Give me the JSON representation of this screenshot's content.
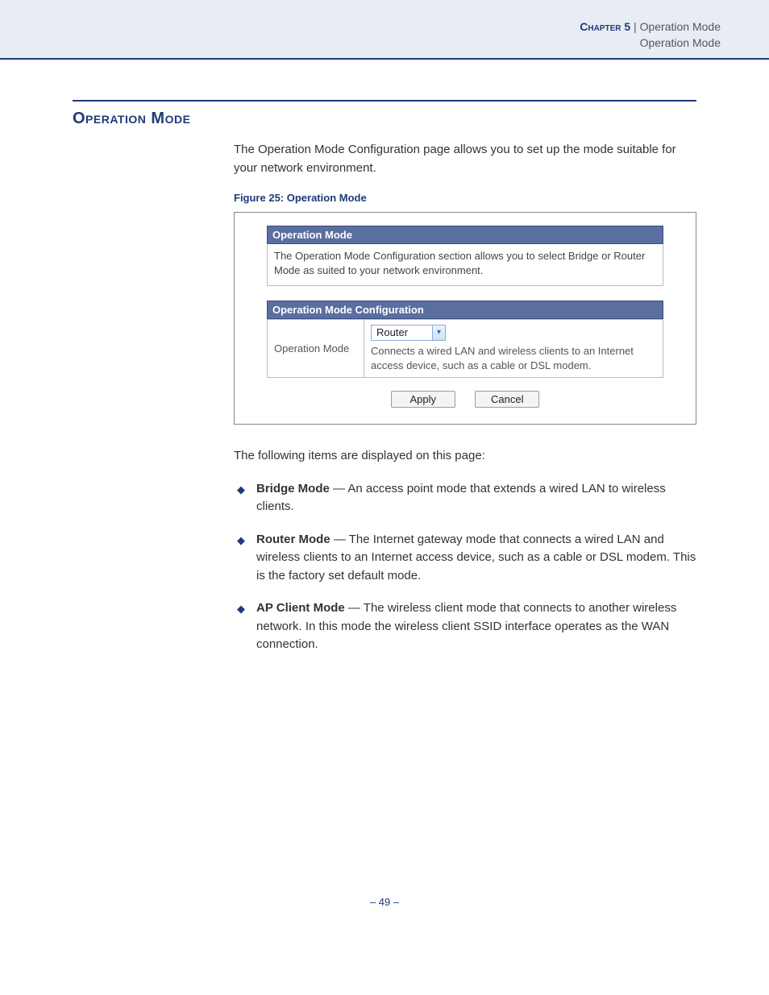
{
  "header": {
    "chapter_label": "Chapter 5",
    "separator": "  |  ",
    "crumb1": "Operation Mode",
    "crumb2": "Operation Mode"
  },
  "section_heading": "Operation Mode",
  "intro_para": "The Operation Mode Configuration page allows you to set up the mode suitable for your network environment.",
  "figure": {
    "caption": "Figure 25:  Operation Mode",
    "panel_title": "Operation Mode",
    "panel_desc": "The Operation Mode Configuration section allows you to select Bridge or Router Mode as suited to your network environment.",
    "cfg_title": "Operation Mode Configuration",
    "row_label": "Operation Mode",
    "select_value": "Router",
    "hint": "Connects a wired LAN and wireless clients to an Internet access device, such as a cable or DSL modem.",
    "apply": "Apply",
    "cancel": "Cancel"
  },
  "followup_para": "The following items are displayed on this page:",
  "items": [
    {
      "name": "Bridge Mode",
      "desc": " — An access point mode that extends a wired LAN to wireless clients."
    },
    {
      "name": "Router Mode",
      "desc": " — The Internet gateway mode that connects a wired LAN and wireless clients to an Internet access device, such as a cable or DSL modem. This is the factory set default mode."
    },
    {
      "name": "AP Client Mode",
      "desc": " — The wireless client mode that connects to another wireless network. In this mode the wireless client SSID interface operates as the WAN connection."
    }
  ],
  "footer": "–  49  –"
}
